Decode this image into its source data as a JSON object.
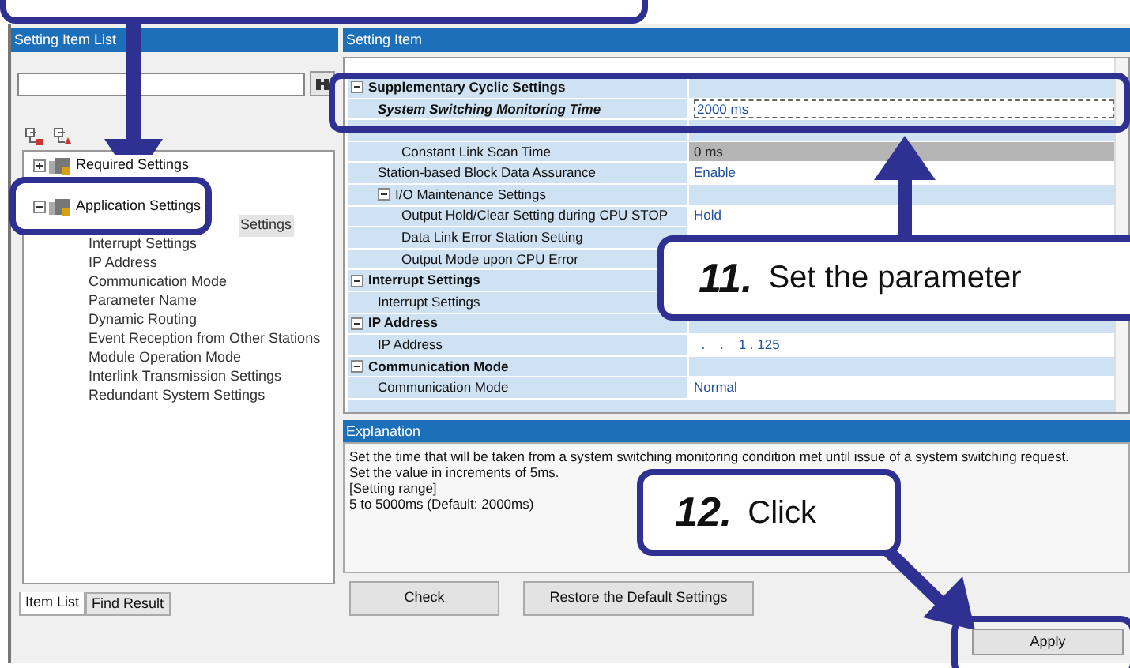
{
  "left_pane": {
    "title": "Setting Item List",
    "tree": [
      {
        "label": "Required Settings",
        "expanded": false
      },
      {
        "label": "Application Settings",
        "expanded": true,
        "children": [
          {
            "label": "Settings",
            "selected": true
          },
          {
            "label": "Interrupt Settings",
            "selected": false
          },
          {
            "label": "IP Address",
            "selected": false
          },
          {
            "label": "Communication Mode",
            "selected": false
          },
          {
            "label": "Parameter Name",
            "selected": false
          },
          {
            "label": "Dynamic Routing",
            "selected": false
          },
          {
            "label": "Event Reception from Other Stations",
            "selected": false
          },
          {
            "label": "Module Operation Mode",
            "selected": false
          },
          {
            "label": "Interlink Transmission Settings",
            "selected": false
          },
          {
            "label": "Redundant System Settings",
            "selected": false
          }
        ]
      }
    ],
    "tabs": [
      {
        "label": "Item List",
        "selected": true
      },
      {
        "label": "Find Result",
        "selected": false
      }
    ]
  },
  "right_pane": {
    "title": "Setting Item",
    "grid": [
      {
        "label": "Supplementary Cyclic Settings",
        "expanded": true,
        "children": [
          {
            "label": "System Switching Monitoring Time",
            "value": "2000 ms",
            "selected": true,
            "disabled": false
          },
          {
            "children": [
              {
                "label": "Constant Link Scan Time",
                "value": "0 ms",
                "selected": false,
                "disabled": true
              }
            ]
          },
          {
            "label": "Station-based Block Data Assurance",
            "value": "Enable",
            "selected": false,
            "disabled": false
          },
          {
            "label": "I/O Maintenance Settings",
            "expanded": true,
            "children": [
              {
                "label": "Output Hold/Clear Setting during CPU STOP",
                "value": "Hold",
                "selected": false,
                "disabled": false
              },
              {
                "label": "Data Link Error Station Setting",
                "selected": false
              },
              {
                "label": "Output Mode upon CPU Error",
                "selected": false
              }
            ]
          }
        ]
      },
      {
        "label": "Interrupt Settings",
        "expanded": true,
        "children": [
          {
            "label": "Interrupt Settings",
            "selected": false
          }
        ]
      },
      {
        "label": "IP Address",
        "expanded": true,
        "children": [
          {
            "label": "IP Address",
            "value": "  .    .    1 . 125",
            "selected": false,
            "disabled": false
          }
        ]
      },
      {
        "label": "Communication Mode",
        "expanded": true,
        "children": [
          {
            "label": "Communication Mode",
            "value": "Normal",
            "selected": false,
            "disabled": false
          }
        ]
      }
    ],
    "explanation": {
      "title": "Explanation",
      "lines": [
        "Set the time that will be taken from a system switching monitoring condition met until issue of a system switching request.",
        "Set the value in increments of 5ms.",
        "[Setting range]",
        "5 to 5000ms (Default: 2000ms)"
      ]
    },
    "buttons": [
      "Check",
      "Restore the Default Settings"
    ]
  },
  "apply_button": "Apply",
  "callouts": [
    {
      "step": "11.",
      "text": "Set the parameter"
    },
    {
      "step": "12.",
      "text": "Click"
    }
  ]
}
